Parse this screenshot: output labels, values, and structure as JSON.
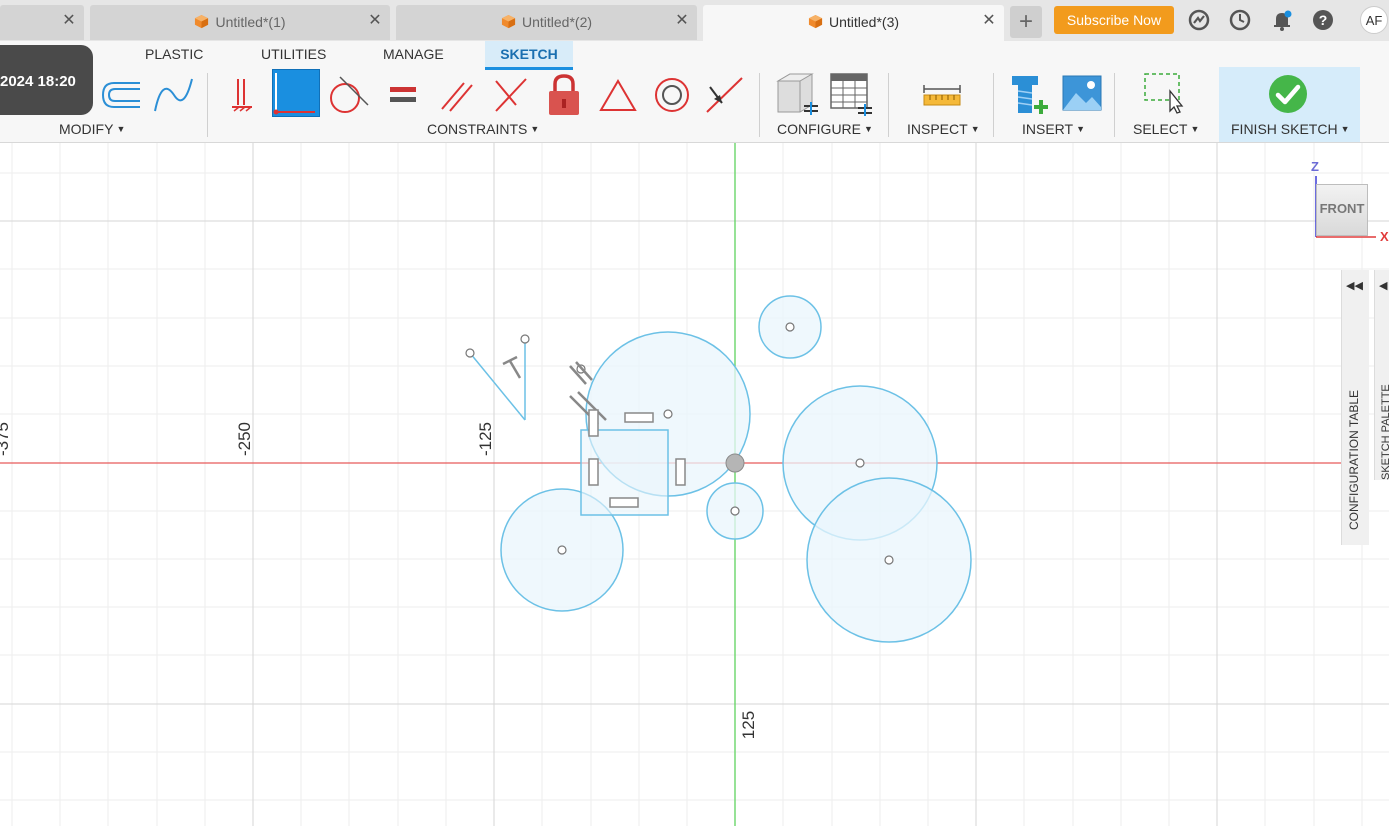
{
  "tabs": [
    {
      "label": "",
      "active": false
    },
    {
      "label": "Untitled*(1)",
      "active": false
    },
    {
      "label": "Untitled*(2)",
      "active": false
    },
    {
      "label": "Untitled*(3)",
      "active": true
    }
  ],
  "header": {
    "new_tab_icon": "plus-icon",
    "subscribe_label": "Subscribe Now",
    "icons": [
      "job-status-icon",
      "history-clock-icon",
      "notifications-bell-icon",
      "help-icon"
    ],
    "avatar_initials": "AF"
  },
  "ribbon": {
    "tabs": [
      "PLASTIC",
      "UTILITIES",
      "MANAGE",
      "SKETCH"
    ],
    "active_tab": "SKETCH",
    "timestamp": "2024 18:20",
    "groups": {
      "modify": "MODIFY",
      "constraints": "CONSTRAINTS",
      "configure": "CONFIGURE",
      "inspect": "INSPECT",
      "insert": "INSERT",
      "select": "SELECT",
      "finish": "FINISH SKETCH"
    }
  },
  "canvas": {
    "axis_labels": {
      "x_neg_375": "-375",
      "x_neg_250": "-250",
      "x_neg_125": "-125",
      "z_125": "125"
    },
    "viewcube": {
      "face": "FRONT",
      "z_axis": "Z",
      "x_axis": "X"
    },
    "side_panels": {
      "configuration_table": "CONFIGURATION TABLE",
      "sketch_palette": "SKETCH PALETTE"
    }
  },
  "colors": {
    "accent_blue": "#1a8fe0",
    "subscribe_orange": "#f29b1d",
    "sketch_blue": "#6cc1e6",
    "sketch_fill": "#e9f5fc",
    "x_axis_red": "#e85a5a",
    "z_axis_green": "#5fd35f",
    "finish_green": "#45b649"
  }
}
